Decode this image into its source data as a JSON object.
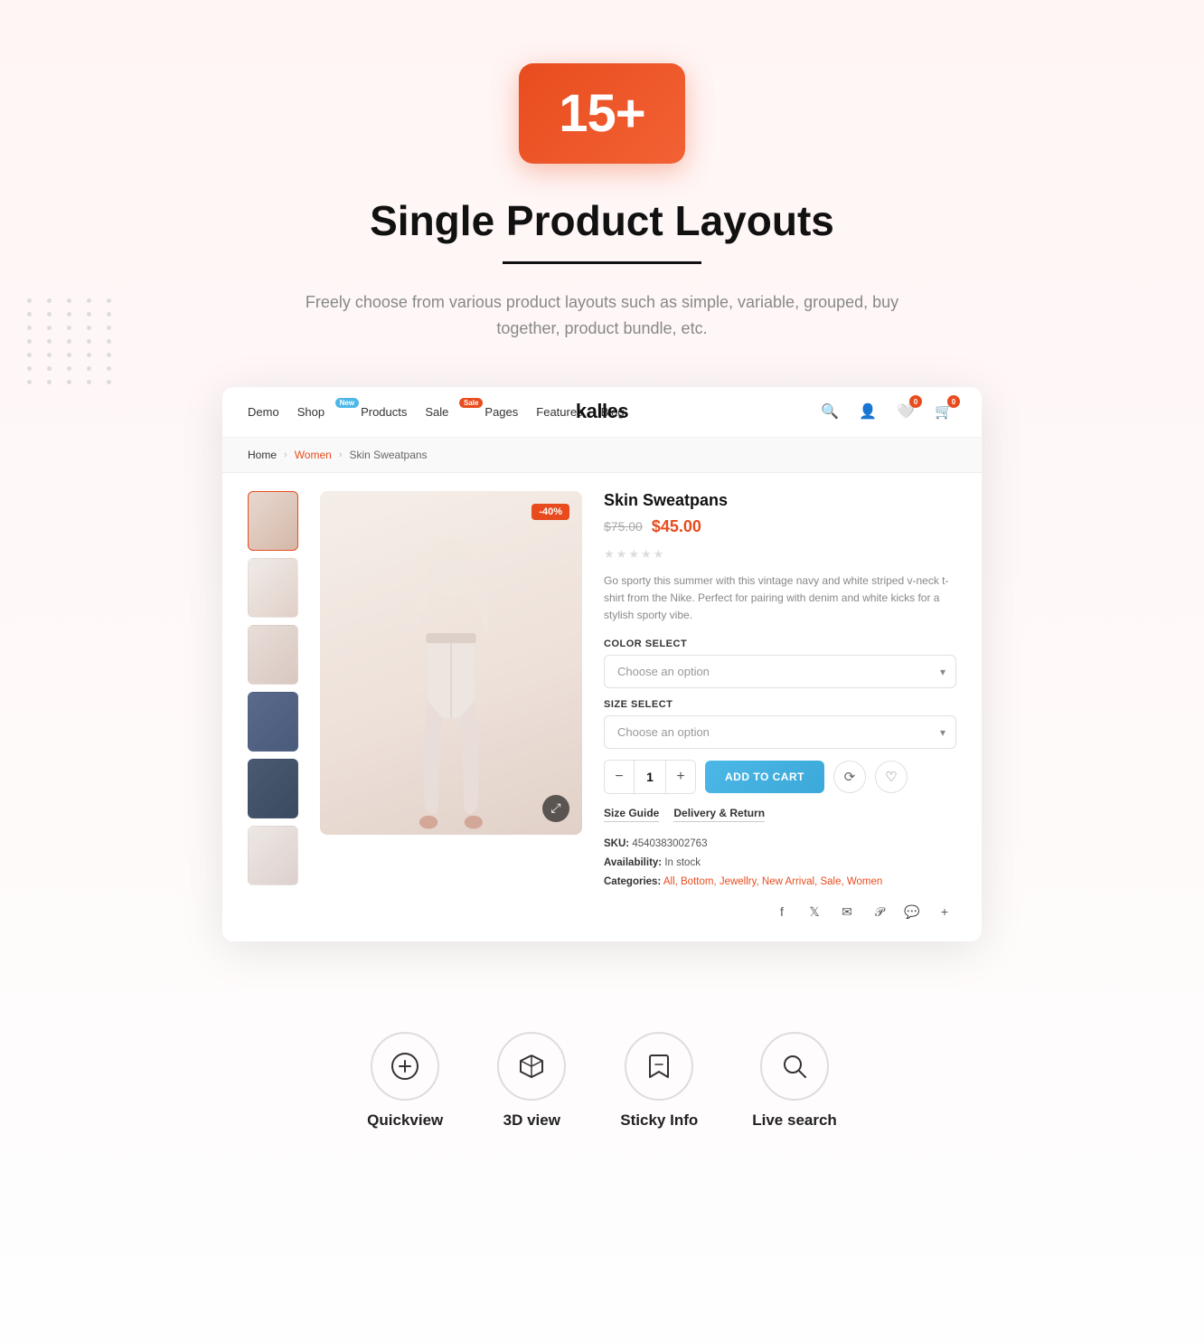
{
  "hero": {
    "badge": "15+",
    "title": "Single Product Layouts",
    "subtitle": "Freely choose from various product layouts such as simple, variable, grouped, buy together, product bundle, etc."
  },
  "nav": {
    "links": [
      {
        "label": "Demo",
        "badge": null
      },
      {
        "label": "Shop",
        "badge": "New"
      },
      {
        "label": "Products",
        "badge": null
      },
      {
        "label": "Sale",
        "badge": "Sale"
      },
      {
        "label": "Pages",
        "badge": null
      },
      {
        "label": "Features",
        "badge": null
      },
      {
        "label": "Blog",
        "badge": null
      }
    ],
    "brand": "kalles",
    "cart_count": "0",
    "wishlist_count": "0"
  },
  "breadcrumb": {
    "home": "Home",
    "women": "Women",
    "current": "Skin Sweatpans"
  },
  "product": {
    "name": "Skin Sweatpans",
    "original_price": "$75.00",
    "sale_price": "$45.00",
    "discount": "-40%",
    "description": "Go sporty this summer with this vintage navy and white striped v-neck t-shirt from the Nike. Perfect for pairing with denim and white kicks for a stylish sporty vibe.",
    "color_label": "COLOR SELECT",
    "color_placeholder": "Choose an option",
    "size_label": "SIZE SELECT",
    "size_placeholder": "Choose an option",
    "qty": "1",
    "add_to_cart": "ADD TO CART",
    "size_guide": "Size Guide",
    "delivery": "Delivery & Return",
    "sku_label": "SKU:",
    "sku_value": "4540383002763",
    "availability_label": "Availability:",
    "availability_value": "In stock",
    "categories_label": "Categories:",
    "categories_value": "All, Bottom, Jewellry, New Arrival, Sale, Women"
  },
  "features": [
    {
      "icon": "plus-circle",
      "label": "Quickview"
    },
    {
      "icon": "cube",
      "label": "3D view"
    },
    {
      "icon": "bookmark",
      "label": "Sticky Info"
    },
    {
      "icon": "search",
      "label": "Live search"
    }
  ]
}
